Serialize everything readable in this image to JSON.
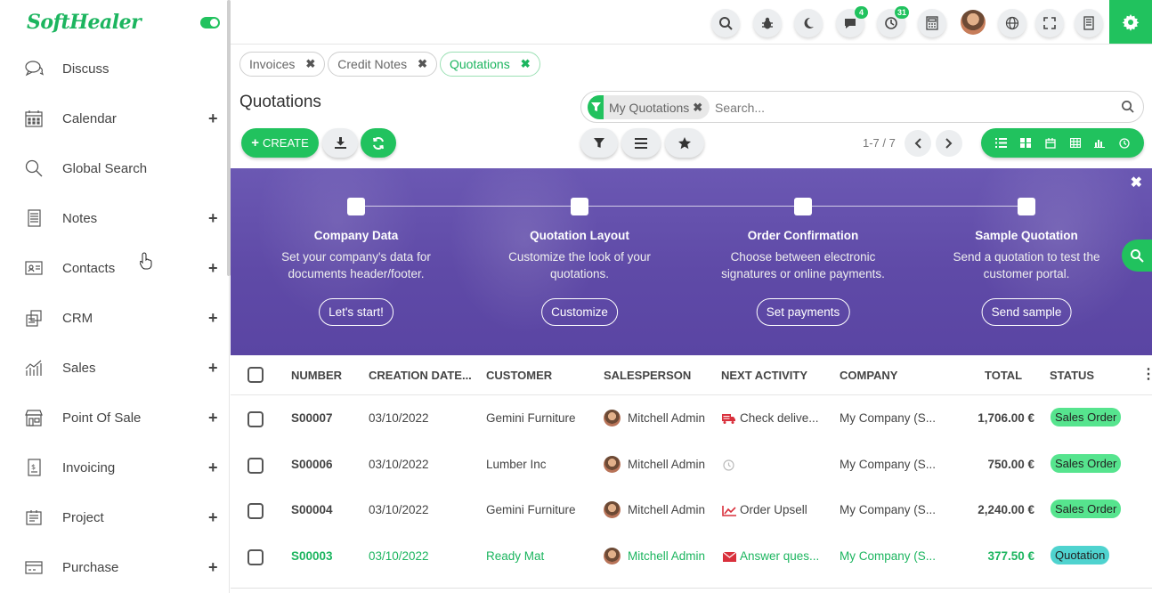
{
  "brand": {
    "name": "SoftHealer"
  },
  "sidebar": {
    "items": [
      {
        "label": "Discuss",
        "icon": "chat-bubbles-icon",
        "has_plus": false
      },
      {
        "label": "Calendar",
        "icon": "calendar-icon",
        "has_plus": true
      },
      {
        "label": "Global Search",
        "icon": "search-icon",
        "has_plus": false
      },
      {
        "label": "Notes",
        "icon": "notes-icon",
        "has_plus": true
      },
      {
        "label": "Contacts",
        "icon": "contact-card-icon",
        "has_plus": true
      },
      {
        "label": "CRM",
        "icon": "crm-icon",
        "has_plus": true
      },
      {
        "label": "Sales",
        "icon": "sales-chart-icon",
        "has_plus": true
      },
      {
        "label": "Point Of Sale",
        "icon": "shop-icon",
        "has_plus": true
      },
      {
        "label": "Invoicing",
        "icon": "invoice-icon",
        "has_plus": true
      },
      {
        "label": "Project",
        "icon": "project-icon",
        "has_plus": true
      },
      {
        "label": "Purchase",
        "icon": "purchase-card-icon",
        "has_plus": true
      }
    ],
    "plus_symbol": "+"
  },
  "topbar": {
    "messages_badge": "4",
    "activities_badge": "31"
  },
  "breadcrumbs": [
    {
      "label": "Invoices",
      "active": false
    },
    {
      "label": "Credit Notes",
      "active": false
    },
    {
      "label": "Quotations",
      "active": true
    }
  ],
  "page": {
    "title": "Quotations"
  },
  "search": {
    "facet": "My Quotations",
    "placeholder": "Search..."
  },
  "controls": {
    "create_label": "CREATE",
    "pager": "1-7 / 7"
  },
  "banner": {
    "steps": [
      {
        "title": "Company Data",
        "desc": "Set your company's data for documents header/footer.",
        "button": "Let's start!"
      },
      {
        "title": "Quotation Layout",
        "desc": "Customize the look of your quotations.",
        "button": "Customize"
      },
      {
        "title": "Order Confirmation",
        "desc": "Choose between electronic signatures or online payments.",
        "button": "Set payments"
      },
      {
        "title": "Sample Quotation",
        "desc": "Send a quotation to test the customer portal.",
        "button": "Send sample"
      }
    ]
  },
  "table": {
    "headers": [
      "NUMBER",
      "CREATION DATE...",
      "CUSTOMER",
      "SALESPERSON",
      "NEXT ACTIVITY",
      "COMPANY",
      "TOTAL",
      "STATUS"
    ],
    "rows": [
      {
        "number": "S00007",
        "date": "03/10/2022",
        "customer": "Gemini Furniture",
        "salesperson": "Mitchell Admin",
        "activity": "Check delive...",
        "activity_icon": "truck-icon",
        "company": "My Company (S...",
        "total": "1,706.00 €",
        "status": "Sales Order",
        "status_type": "sales_order"
      },
      {
        "number": "S00006",
        "date": "03/10/2022",
        "customer": "Lumber Inc",
        "salesperson": "Mitchell Admin",
        "activity": "",
        "activity_icon": "clock-icon",
        "company": "My Company (S...",
        "total": "750.00 €",
        "status": "Sales Order",
        "status_type": "sales_order"
      },
      {
        "number": "S00004",
        "date": "03/10/2022",
        "customer": "Gemini Furniture",
        "salesperson": "Mitchell Admin",
        "activity": "Order Upsell",
        "activity_icon": "chart-line-icon",
        "company": "My Company (S...",
        "total": "2,240.00 €",
        "status": "Sales Order",
        "status_type": "sales_order"
      },
      {
        "number": "S00003",
        "date": "03/10/2022",
        "customer": "Ready Mat",
        "salesperson": "Mitchell Admin",
        "activity": "Answer ques...",
        "activity_icon": "envelope-icon",
        "company": "My Company (S...",
        "total": "377.50 €",
        "status": "Quotation",
        "status_type": "quotation"
      }
    ]
  },
  "colors": {
    "accent": "#21c25e",
    "banner": "#5f4aa7",
    "status_sales_order": "#56e48e",
    "status_quotation": "#4fd3cf"
  }
}
